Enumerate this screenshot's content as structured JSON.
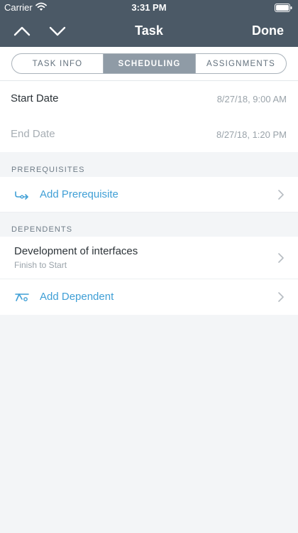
{
  "status_bar": {
    "carrier": "Carrier",
    "time": "3:31 PM"
  },
  "nav": {
    "title": "Task",
    "done_label": "Done"
  },
  "tabs": [
    {
      "label": "TASK INFO",
      "active": false
    },
    {
      "label": "SCHEDULING",
      "active": true
    },
    {
      "label": "ASSIGNMENTS",
      "active": false
    }
  ],
  "dates": {
    "start": {
      "label": "Start Date",
      "value": "8/27/18, 9:00 AM"
    },
    "end": {
      "label": "End Date",
      "value": "8/27/18, 1:20 PM"
    }
  },
  "prerequisites": {
    "header": "PREREQUISITES",
    "add_label": "Add Prerequisite"
  },
  "dependents": {
    "header": "DEPENDENTS",
    "items": [
      {
        "title": "Development of interfaces",
        "subtitle": "Finish to Start"
      }
    ],
    "add_label": "Add Dependent"
  },
  "colors": {
    "header_bg": "#4b5966",
    "accent": "#3f9fd6",
    "active_tab": "#8f9ba6",
    "background": "#f3f5f7"
  },
  "icons": {
    "prerequisite": "link-prerequisite-icon",
    "dependent": "link-dependent-icon",
    "disclosure": "chevron-right-icon"
  }
}
